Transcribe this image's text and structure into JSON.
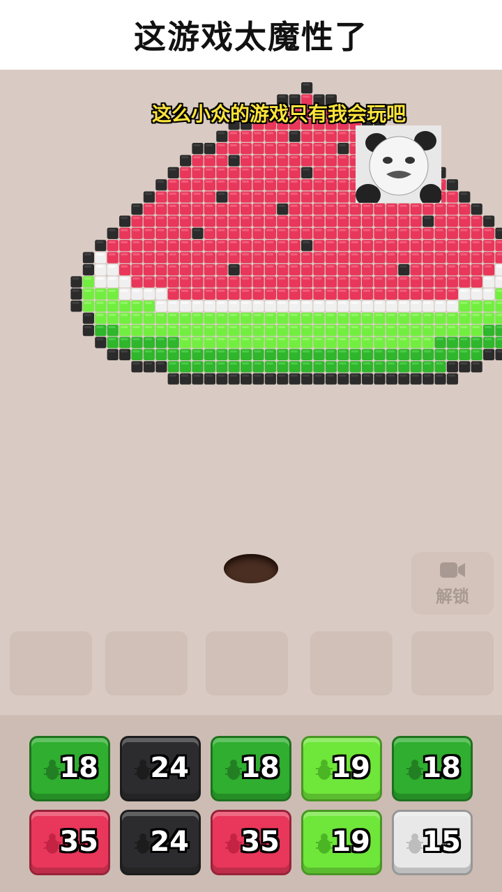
{
  "header": {
    "title": "这游戏太魔性了"
  },
  "caption": "这么小众的游戏只有我会玩吧",
  "unlock": {
    "label": "解锁",
    "icon": "video-camera-icon"
  },
  "colors": {
    "background": "#d9cbc3",
    "red": "#e8375a",
    "green_light": "#6fee3f",
    "green_dark": "#2fb62c",
    "black": "#2a2a2a",
    "white": "#f2f2f2"
  },
  "pixel_art": {
    "subject": "watermelon",
    "rows": [
      ".........................................",
      ".....................K...................",
      "...................KKRKK.................",
      ".................KKRRRRRKK...............",
      "...............KKRRRRRRRRRKK.............",
      "..............KRRRRRKRRRRRRRK............",
      "............KKRRRRRRRRRRKRRRRKK..........",
      "...........KRRRKRRRRRRRRRRRRRRRK.........",
      "..........KRRRRRRRRRRKRRRRRRRRRRK........",
      ".........KRRRRRRRRRRRRRRRRRRKRRRRK.......",
      "........KRRRRRKRRRRRRRRRRRRRRRRRRRK......",
      ".......KRRRRRRRRRRRKRRRRRRRRRRRRRRRK.....",
      "......KRRRRRRRRRRRRRRRRRRRRRRRRKRRRRK....",
      ".....KRRRRRRKRRRRRRRRRRRRRRRRRRRRRRRRK...",
      "....KRRRRRRRRRRRRRRRRKRRRRRRRRRRRRRRRRK..",
      "...KWRRRRRRRRRRRRRRRRRRRRRRRRRRRRRRRRRWK.",
      "...KWWRRRRRRRRRKRRRRRRRRRRRRRKRRRRRRRWWK.",
      "..KLWWWRRRRRRRRRRRRRRRRRRRRRRRRRRRRRWWLLK",
      "..KLLLWWWWRRRRRRRRRRRRRRRRRRRRRRRRWWWLLLK",
      "..KLLLLLLWWWWWWWWWWWWWWWWWWWWWWWWWLLLLLLK",
      "...KLLLLLLLLLLLLLLLLLLLLLLLLLLLLLLLLLLLK.",
      "...KGGLLLLLLLLLLLLLLLLLLLLLLLLLLLLLLGGGK.",
      "....KGGGGGGLLLLLLLLLLLLLLLLLLLLLGGGGGGK..",
      ".....KKGGGGGGGGGGGGGGGGGGGGGGGGGGGGGKK...",
      ".......KKKGGGGGGGGGGGGGGGGGGGGGGGKKK.....",
      "..........KKKKKKKKKKKKKKKKKKKKKKKK.......",
      "........................................."
    ]
  },
  "slots": [
    {
      "state": "empty"
    },
    {
      "state": "empty"
    },
    {
      "state": "empty"
    },
    {
      "state": "empty"
    },
    {
      "state": "empty"
    }
  ],
  "tiles": [
    [
      {
        "value": "18",
        "color": "green"
      },
      {
        "value": "24",
        "color": "black"
      },
      {
        "value": "18",
        "color": "green"
      },
      {
        "value": "19",
        "color": "lightgreen"
      },
      {
        "value": "18",
        "color": "green"
      }
    ],
    [
      {
        "value": "35",
        "color": "red"
      },
      {
        "value": "24",
        "color": "black"
      },
      {
        "value": "35",
        "color": "red"
      },
      {
        "value": "19",
        "color": "lightgreen"
      },
      {
        "value": "15",
        "color": "white"
      }
    ]
  ]
}
